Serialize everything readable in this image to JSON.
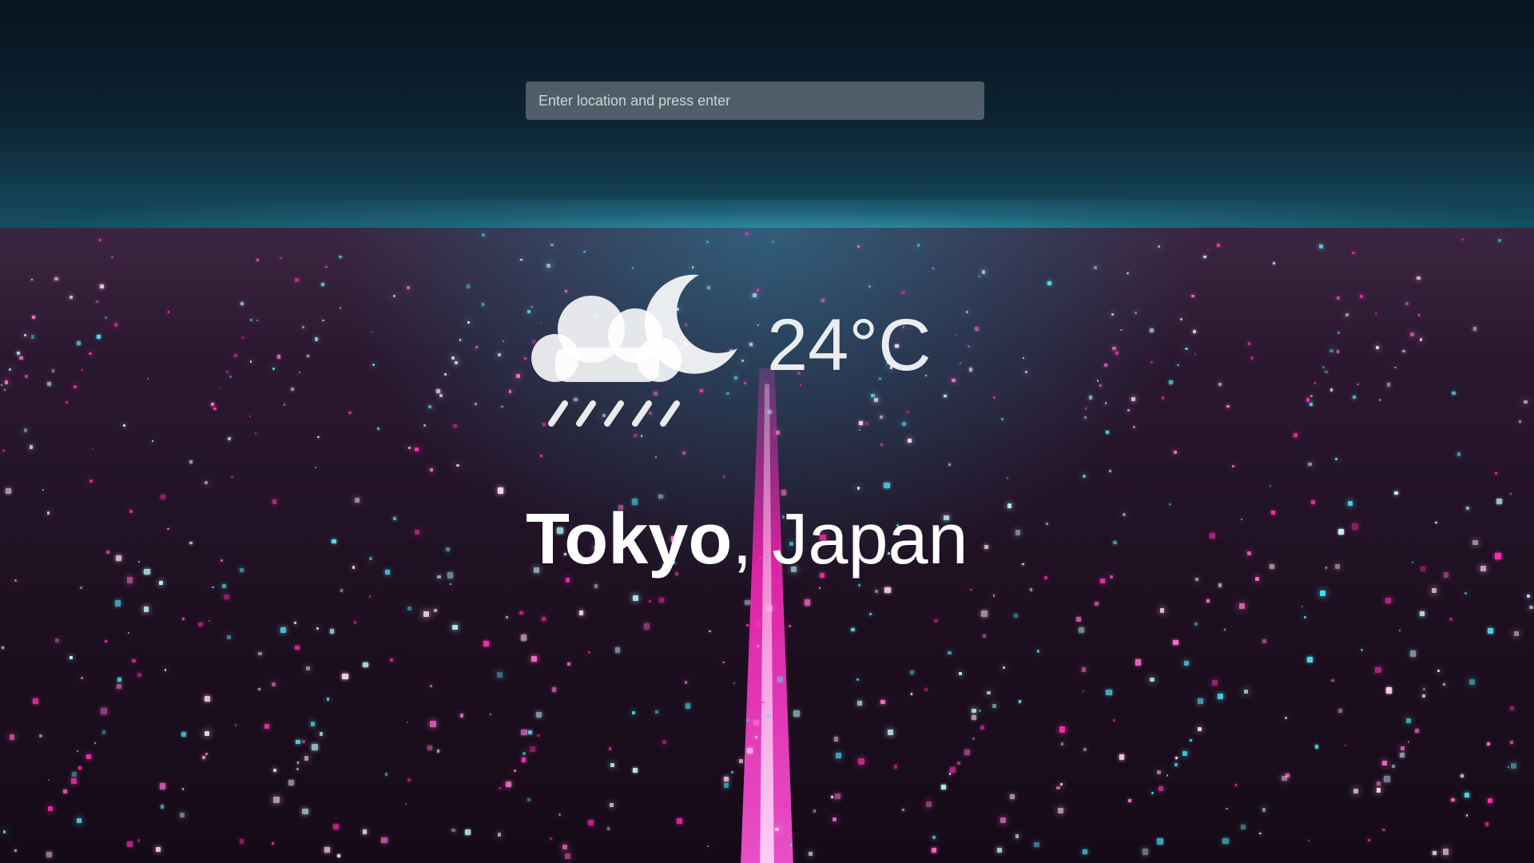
{
  "search": {
    "placeholder": "Enter location and press enter",
    "value": ""
  },
  "weather": {
    "icon": "night-rain-icon",
    "temperature": "24°C"
  },
  "location": {
    "city": "Tokyo",
    "separator": ",",
    "country": "Japan"
  },
  "colors": {
    "text": "#ffffff",
    "input_background": "rgba(255,255,255,0.28)",
    "city_magenta": "#ff2fb4",
    "city_cyan": "#4fe0f0"
  }
}
